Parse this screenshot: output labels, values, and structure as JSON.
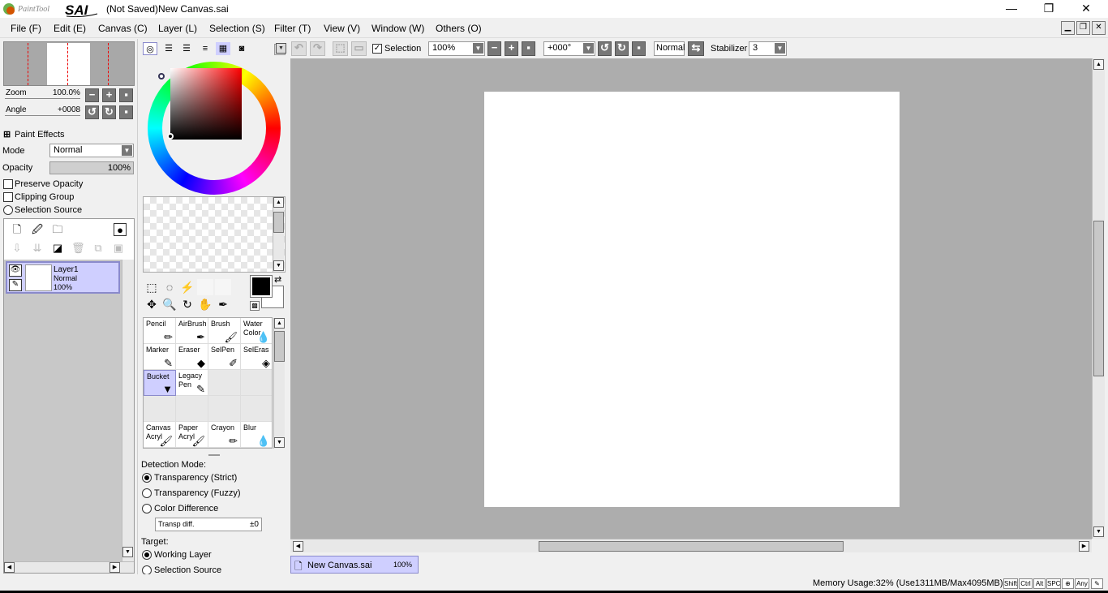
{
  "title": "(Not Saved)New Canvas.sai",
  "logo_text": "PaintTool SAI",
  "menu": [
    "File (F)",
    "Edit (E)",
    "Canvas (C)",
    "Layer (L)",
    "Selection (S)",
    "Filter (T)",
    "View (V)",
    "Window (W)",
    "Others (O)"
  ],
  "navigator": {
    "zoom_label": "Zoom",
    "zoom_value": "100.0%",
    "angle_label": "Angle",
    "angle_value": "+0008"
  },
  "paint_effects": "Paint Effects",
  "mode": {
    "label": "Mode",
    "value": "Normal"
  },
  "opacity": {
    "label": "Opacity",
    "value": "100%"
  },
  "checks": {
    "preserve": "Preserve Opacity",
    "clipping": "Clipping Group",
    "selsource": "Selection Source"
  },
  "layer": {
    "name": "Layer1",
    "mode": "Normal",
    "opacity": "100%"
  },
  "toolbar": {
    "selection": "Selection",
    "zoom": "100%",
    "angle": "+000°",
    "blend": "Normal",
    "stabilizer_label": "Stabilizer",
    "stabilizer_value": "3"
  },
  "tools": [
    {
      "n": "Pencil",
      "i": "✏"
    },
    {
      "n": "AirBrush",
      "i": "✒"
    },
    {
      "n": "Brush",
      "i": "🖌"
    },
    {
      "n": "Water Color",
      "i": "💧"
    },
    {
      "n": "Marker",
      "i": "✎"
    },
    {
      "n": "Eraser",
      "i": "◆"
    },
    {
      "n": "SelPen",
      "i": "✐"
    },
    {
      "n": "SelEras",
      "i": "◈"
    },
    {
      "n": "Bucket",
      "i": "▼"
    },
    {
      "n": "Legacy Pen",
      "i": "✎"
    },
    {
      "n": "",
      "i": ""
    },
    {
      "n": "",
      "i": ""
    },
    {
      "n": "",
      "i": ""
    },
    {
      "n": "",
      "i": ""
    },
    {
      "n": "",
      "i": ""
    },
    {
      "n": "",
      "i": ""
    },
    {
      "n": "Canvas Acryl",
      "i": "🖌"
    },
    {
      "n": "Paper Acryl",
      "i": "🖌"
    },
    {
      "n": "Crayon",
      "i": "✏"
    },
    {
      "n": "Blur",
      "i": "💧"
    }
  ],
  "detection": {
    "title": "Detection Mode:",
    "opts": [
      "Transparency (Strict)",
      "Transparency (Fuzzy)",
      "Color Difference"
    ],
    "transp_label": "Transp diff.",
    "transp_value": "±0"
  },
  "target": {
    "title": "Target:",
    "opts": [
      "Working Layer",
      "Selection Source"
    ]
  },
  "doc_tab": {
    "name": "New Canvas.sai",
    "zoom": "100%"
  },
  "status": {
    "memory": "Memory Usage:32% (Use1311MB/Max4095MB)",
    "keys": [
      "Shift",
      "Ctrl",
      "Alt",
      "SPC",
      "Any"
    ]
  },
  "colors": {
    "fg": "#000000",
    "bg": "#ffffff",
    "canvas_bg": "#adadad"
  }
}
